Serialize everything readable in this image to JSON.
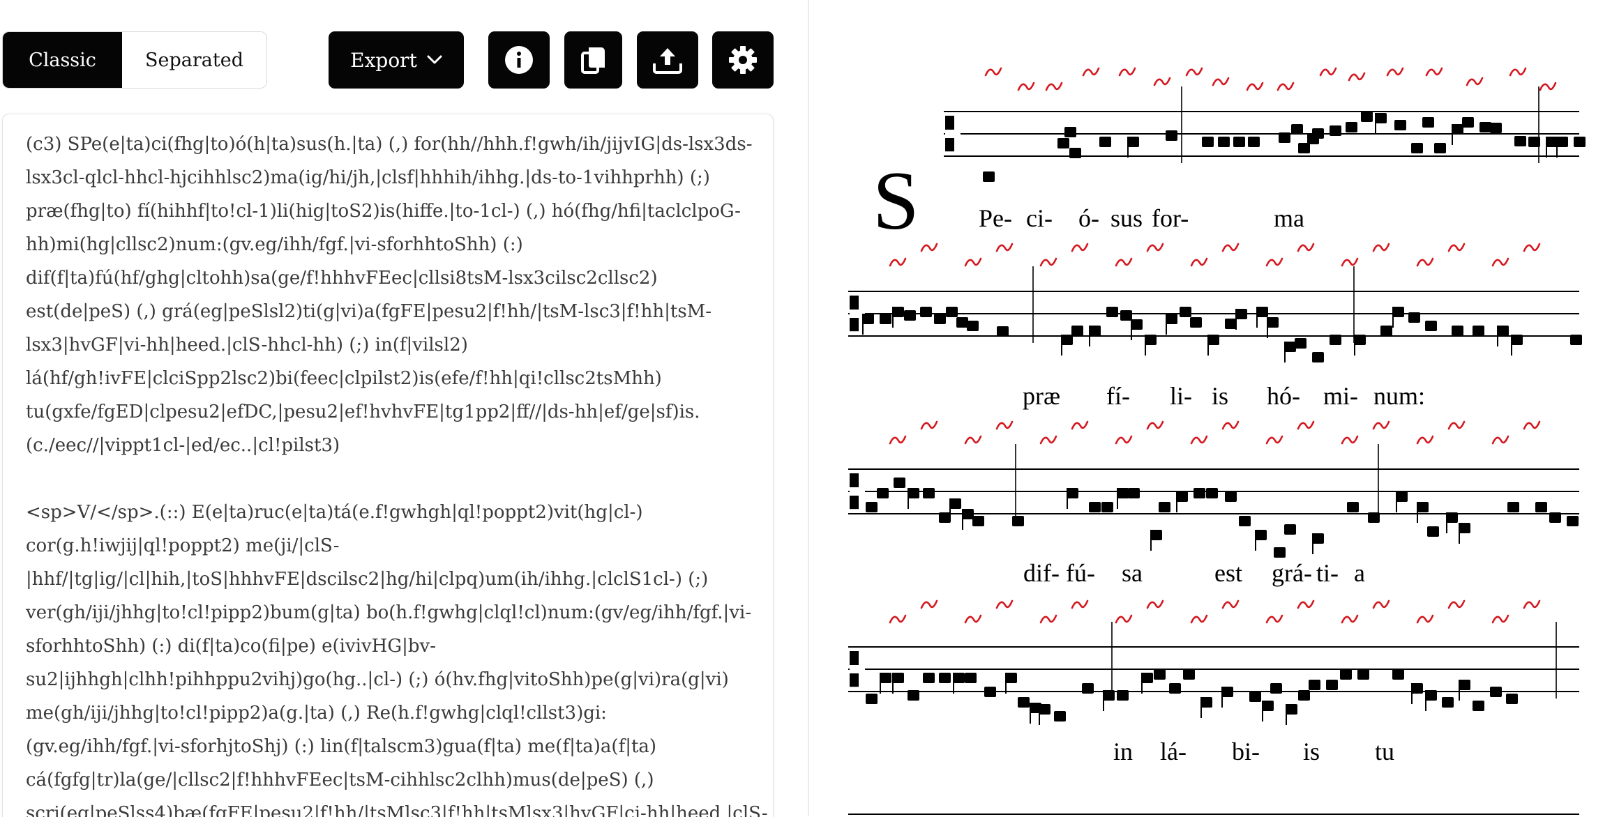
{
  "toolbar": {
    "mode_classic": "Classic",
    "mode_separated": "Separated",
    "export_label": "Export",
    "icons": [
      "chevron-down-icon",
      "info-icon",
      "copy-icon",
      "upload-icon",
      "gear-icon"
    ]
  },
  "editor": {
    "lines": [
      "(c3) SPe(e|ta)ci(fhg|to)ó(h|ta)sus(h.|ta) (,) for(hh//hhh.f!gwh/ih/jijvIG|ds-lsx3ds-",
      "lsx3cl-qlcl-hhcl-hjcihhlsc2)ma(ig/hi/jh,|clsf|hhhih/ihhg.|ds-to-1vihhprhh) (;)",
      "præ(fhg|to) fí(hihhf|to!cl-1)li(hig|toS2)is(hiffe.|to-1cl-) (,) hó(fhg/hfi|taclclpoG-",
      "hh)mi(hg|cllsc2)num:(gv.eg/ihh/fgf.|vi-sforhhtoShh) (:)",
      "dif(f|ta)fú(hf/ghg|cltohh)sa(ge/f!hhhvFEec|cllsi8tsM-lsx3cilsc2cllsc2)",
      "est(de|peS) (,) grá(eg|peSlsl2)ti(g|vi)a(fgFE|pesu2|f!hh/|tsM-lsc3|f!hh|tsM-",
      "lsx3|hvGF|vi-hh|heed.|clS-hhcl-hh) (;) in(f|vilsl2)",
      "lá(hf/gh!ivFE|clciSpp2lsc2)bi(feec|clpilst2)is(efe/f!hh|qi!cllsc2tsMhh)",
      "tu(gxfe/fgED|clpesu2|efDC,|pesu2|ef!hvhvFE|tg1pp2|ff//|ds-hh|ef/ge|sf)is.",
      "(c./eec//|vippt1cl-|ed/ec..|cl!pilst3)",
      "",
      "<sp>V/</sp>.(::) E(e|ta)ruc(e|ta)tá(e.f!gwhgh|ql!poppt2)vit(hg|cl-)",
      "cor(g.h!iwjij|ql!poppt2) me(ji/|clS-",
      "|hhf/|tg|ig/|cl|hih,|toS|hhhvFE|dscilsc2|hg/hi|clpq)um(ih/ihhg.|clclS1cl-) (;)",
      "ver(gh/iji/jhhg|to!cl!pipp2)bum(g|ta) bo(h.f!gwhg|clql!cl)num:(gv/eg/ihh/fgf.|vi-",
      "sforhhtoShh) (:) di(f|ta)co(fi|pe) e(ivivHG|bv-",
      "su2|ijhhgh|clhh!pihhppu2vihj)go(hg..|cl-) (;) ó(hv.fhg|vitoShh)pe(g|vi)ra(g|vi)",
      "me(gh/iji/jhhg|to!cl!pipp2)a(g.|ta) (,) Re(h.f!gwhg|clql!cllst3)gi:",
      "(gv.eg/ihh/fgf.|vi-sforhjtoShj) (:) lin(f|talscm3)gua(f|ta) me(f|ta)a(f|ta)",
      "cá(fgfg|tr)la(ge/|cllsc2|f!hhhvFEec|tsM-cihhlsc2clhh)mus(de|peS) (,)",
      "scri(eg|peSlss4)bæ(fgFE|pesu2|f!hh/|tsMlsc3|f!hh|tsMlsx3|hvGF|ci-hh|heed.|clS-"
    ]
  },
  "score": {
    "initial": "S",
    "systems": [
      {
        "syllables": [
          "Pe-",
          "ci-",
          "ó-",
          "sus",
          "for-",
          "ma"
        ]
      },
      {
        "syllables": [
          "præ",
          "fí-",
          "li-",
          "is",
          "hó-",
          "mi-",
          "num:"
        ]
      },
      {
        "syllables": [
          "dif-",
          "fú-",
          "sa",
          "est",
          "grá-",
          "ti-",
          "a"
        ]
      },
      {
        "syllables": [
          "in",
          "lá-",
          "bi-",
          "is",
          "tu"
        ]
      }
    ]
  },
  "colors": {
    "ink": "#000000",
    "neumes": "#d4181f",
    "button": "#050505"
  }
}
